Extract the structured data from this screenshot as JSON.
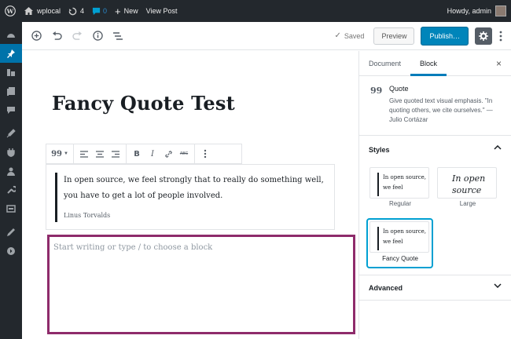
{
  "adminbar": {
    "site_name": "wplocal",
    "updates_count": "4",
    "comments_count": "0",
    "new_label": "New",
    "view_post_label": "View Post",
    "greeting": "Howdy, admin"
  },
  "editor_toolbar": {
    "saved_label": "Saved",
    "preview_label": "Preview",
    "publish_label": "Publish…"
  },
  "post": {
    "title": "Fancy Quote Test",
    "quote_text": "In open source, we feel strongly that to really do something well, you have to get a lot of people involved.",
    "quote_citation": "Linus Torvalds",
    "placeholder": "Start writing or type / to choose a block"
  },
  "block_toolbar": {
    "format_abc_label": "ABC"
  },
  "panel": {
    "tabs": [
      "Document",
      "Block"
    ],
    "active_tab": "Block",
    "block_card": {
      "icon_glyph": "99",
      "title": "Quote",
      "description": "Give quoted text visual emphasis. \"In quoting others, we cite ourselves.\" — Julio Cortázar"
    },
    "styles_label": "Styles",
    "styles": [
      {
        "label": "Regular",
        "preview": "In open source, we feel"
      },
      {
        "label": "Large",
        "preview": "In open source"
      },
      {
        "label": "Fancy Quote",
        "preview": "In open source, we feel"
      }
    ],
    "selected_style": "Fancy Quote",
    "advanced_label": "Advanced"
  },
  "colors": {
    "admin_bar": "#23282d",
    "active_menu": "#0073aa",
    "publish_button": "#0085ba",
    "focus_block_border": "#8e2b6b",
    "selected_style_border": "#00a0d2"
  }
}
